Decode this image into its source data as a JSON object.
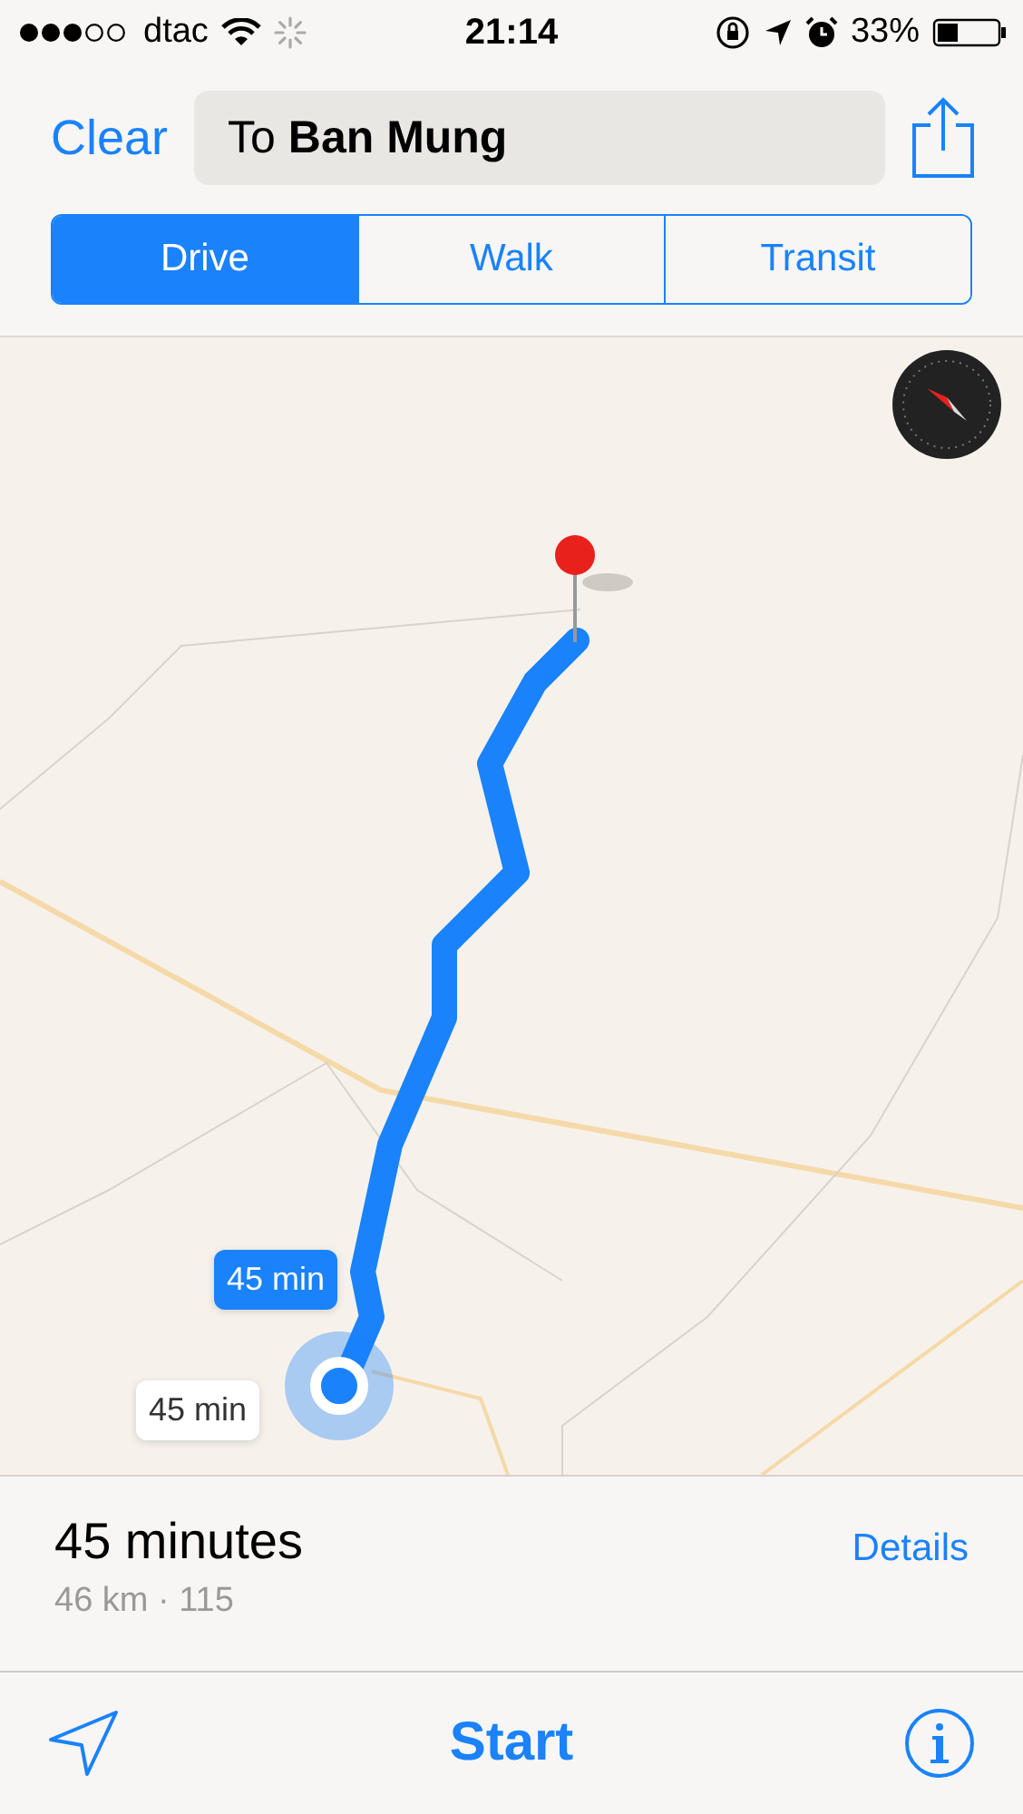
{
  "status_bar": {
    "carrier": "dtac",
    "time": "21:14",
    "battery": "33%"
  },
  "header": {
    "clear_button": "Clear",
    "destination_field": "To **Ban Mung**"
  },
  "modes": [
    {
      "label": "Drive",
      "selected": true
    },
    {
      "label": "Walk",
      "selected": false
    },
    {
      "label": "Transit",
      "selected": false
    }
  ],
  "route_callouts": [
    {
      "text": "45 min",
      "selected": true
    },
    {
      "text": "45 min",
      "selected": false
    }
  ],
  "summary": {
    "duration": "45 minutes",
    "distance": "46 km · 115",
    "details_link": "Details"
  },
  "toolbar": {
    "start_button": "Start"
  }
}
